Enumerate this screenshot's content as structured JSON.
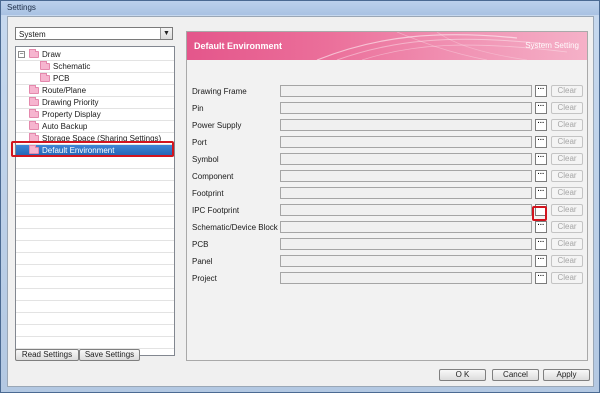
{
  "window": {
    "title": "Settings"
  },
  "category_select": {
    "value": "System"
  },
  "tree": [
    {
      "label": "Draw",
      "level": 0,
      "expander": "−",
      "selected": false
    },
    {
      "label": "Schematic",
      "level": 1,
      "selected": false
    },
    {
      "label": "PCB",
      "level": 1,
      "selected": false
    },
    {
      "label": "Route/Plane",
      "level": 0,
      "selected": false
    },
    {
      "label": "Drawing Priority",
      "level": 0,
      "selected": false
    },
    {
      "label": "Property Display",
      "level": 0,
      "selected": false
    },
    {
      "label": "Auto Backup",
      "level": 0,
      "selected": false
    },
    {
      "label": "Storage Space (Sharing Settings)",
      "level": 0,
      "selected": false
    },
    {
      "label": "Default Environment",
      "level": 0,
      "selected": true
    }
  ],
  "left_buttons": {
    "read": "Read Settings",
    "save": "Save Settings"
  },
  "panel": {
    "title": "Default Environment",
    "subtitle": "System Setting",
    "rows": [
      {
        "label": "Drawing Frame",
        "value": "",
        "clear": "Clear",
        "browse": "···"
      },
      {
        "label": "Pin",
        "value": "",
        "clear": "Clear",
        "browse": "···"
      },
      {
        "label": "Power Supply",
        "value": "",
        "clear": "Clear",
        "browse": "···"
      },
      {
        "label": "Port",
        "value": "",
        "clear": "Clear",
        "browse": "···"
      },
      {
        "label": "Symbol",
        "value": "",
        "clear": "Clear",
        "browse": "···"
      },
      {
        "label": "Component",
        "value": "",
        "clear": "Clear",
        "browse": "···"
      },
      {
        "label": "Footprint",
        "value": "",
        "clear": "Clear",
        "browse": "···"
      },
      {
        "label": "IPC Footprint",
        "value": "",
        "clear": "Clear",
        "browse": "···"
      },
      {
        "label": "Schematic/Device Block",
        "value": "",
        "clear": "Clear",
        "browse": "···"
      },
      {
        "label": "PCB",
        "value": "",
        "clear": "Clear",
        "browse": "···"
      },
      {
        "label": "Panel",
        "value": "",
        "clear": "Clear",
        "browse": "···"
      },
      {
        "label": "Project",
        "value": "",
        "clear": "Clear",
        "browse": "···"
      }
    ]
  },
  "dialog_buttons": {
    "ok": "O K",
    "cancel": "Cancel",
    "apply": "Apply"
  },
  "colors": {
    "accent_pink": "#e4568b",
    "selection_blue": "#2f74c6",
    "highlight_red": "#d2141e"
  }
}
